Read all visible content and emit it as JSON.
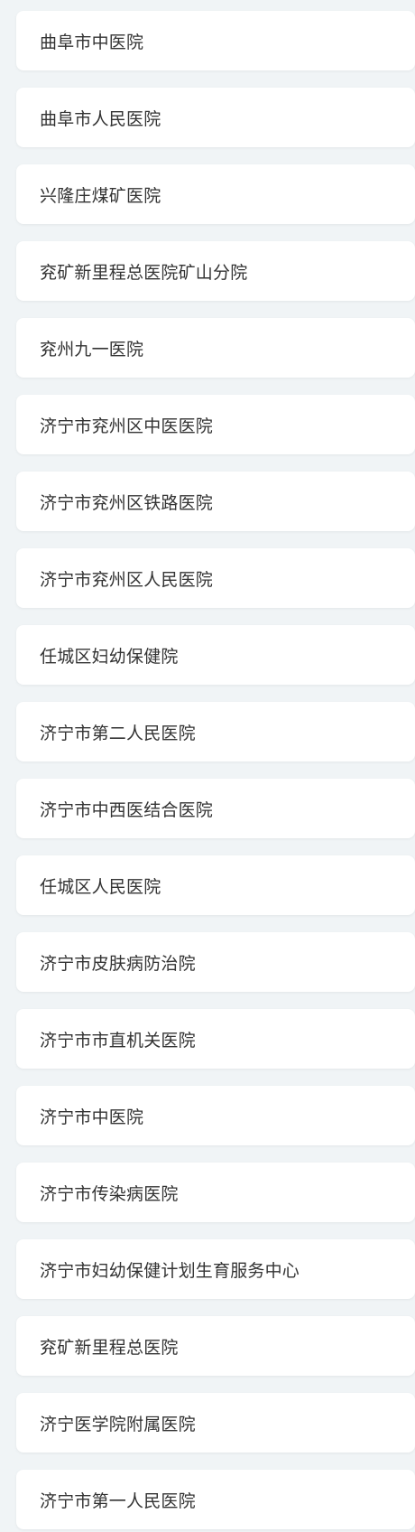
{
  "hospitals": [
    "曲阜市中医院",
    "曲阜市人民医院",
    "兴隆庄煤矿医院",
    "兖矿新里程总医院矿山分院",
    "兖州九一医院",
    "济宁市兖州区中医医院",
    "济宁市兖州区铁路医院",
    "济宁市兖州区人民医院",
    "任城区妇幼保健院",
    "济宁市第二人民医院",
    "济宁市中西医结合医院",
    "任城区人民医院",
    "济宁市皮肤病防治院",
    "济宁市市直机关医院",
    "济宁市中医院",
    "济宁市传染病医院",
    "济宁市妇幼保健计划生育服务中心",
    "兖矿新里程总医院",
    "济宁医学院附属医院",
    "济宁市第一人民医院"
  ]
}
